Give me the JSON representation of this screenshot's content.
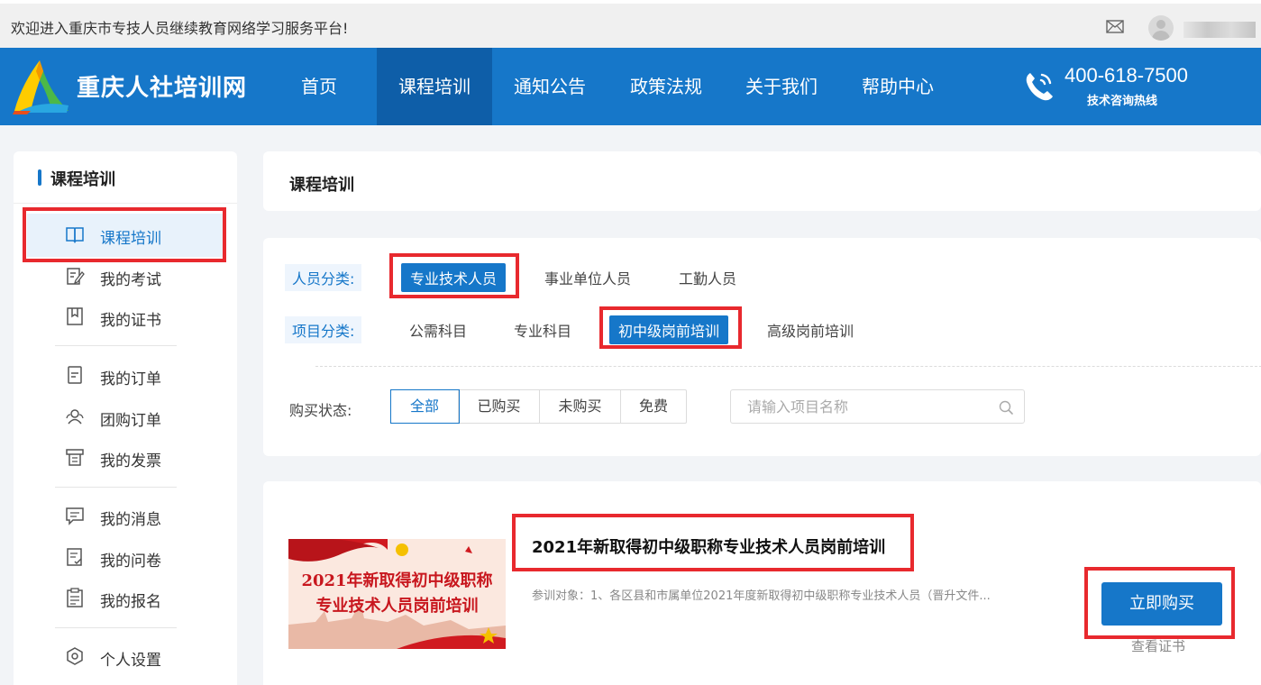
{
  "topbar": {
    "welcome": "欢迎进入重庆市专技人员继续教育网络学习服务平台!",
    "icons": [
      "mail-icon",
      "avatar"
    ]
  },
  "nav": {
    "brand": "重庆人社培训网",
    "items": [
      {
        "label": "首页"
      },
      {
        "label": "课程培训",
        "active": true
      },
      {
        "label": "通知公告"
      },
      {
        "label": "政策法规"
      },
      {
        "label": "关于我们"
      },
      {
        "label": "帮助中心"
      }
    ],
    "hotline": "400-618-7500",
    "hotline_sub": "技术咨询热线"
  },
  "sidebar": {
    "title": "课程培训",
    "items": [
      {
        "label": "课程培训",
        "icon": "book-icon",
        "active": true
      },
      {
        "label": "我的考试",
        "icon": "exam-icon"
      },
      {
        "label": "我的证书",
        "icon": "certificate-icon"
      },
      {
        "label": "我的订单",
        "icon": "order-icon"
      },
      {
        "label": "团购订单",
        "icon": "group-order-icon"
      },
      {
        "label": "我的发票",
        "icon": "invoice-icon"
      },
      {
        "label": "我的消息",
        "icon": "message-icon"
      },
      {
        "label": "我的问卷",
        "icon": "survey-icon"
      },
      {
        "label": "我的报名",
        "icon": "registration-icon"
      },
      {
        "label": "个人设置",
        "icon": "settings-icon"
      }
    ]
  },
  "main": {
    "page_title": "课程培训",
    "filters": {
      "person_label": "人员分类:",
      "person_options": [
        "专业技术人员",
        "事业单位人员",
        "工勤人员"
      ],
      "project_label": "项目分类:",
      "project_options": [
        "公需科目",
        "专业科目",
        "初中级岗前培训",
        "高级岗前培训"
      ],
      "status_label": "购买状态:",
      "status_options": [
        "全部",
        "已购买",
        "未购买",
        "免费"
      ],
      "search_placeholder": "请输入项目名称"
    },
    "course": {
      "thumb_line1": "2021年新取得初中级职称",
      "thumb_line2": "专业技术人员岗前培训",
      "title": "2021年新取得初中级职称专业技术人员岗前培训",
      "desc": "参训对象：1、各区县和市属单位2021年度新取得初中级职称专业技术人员（晋升文件...",
      "buy_label": "立即购买",
      "cert_label": "查看证书"
    }
  },
  "colors": {
    "brand_blue": "#1677c9",
    "nav_active": "#0e5ea8",
    "highlight_red": "#e8292e"
  }
}
